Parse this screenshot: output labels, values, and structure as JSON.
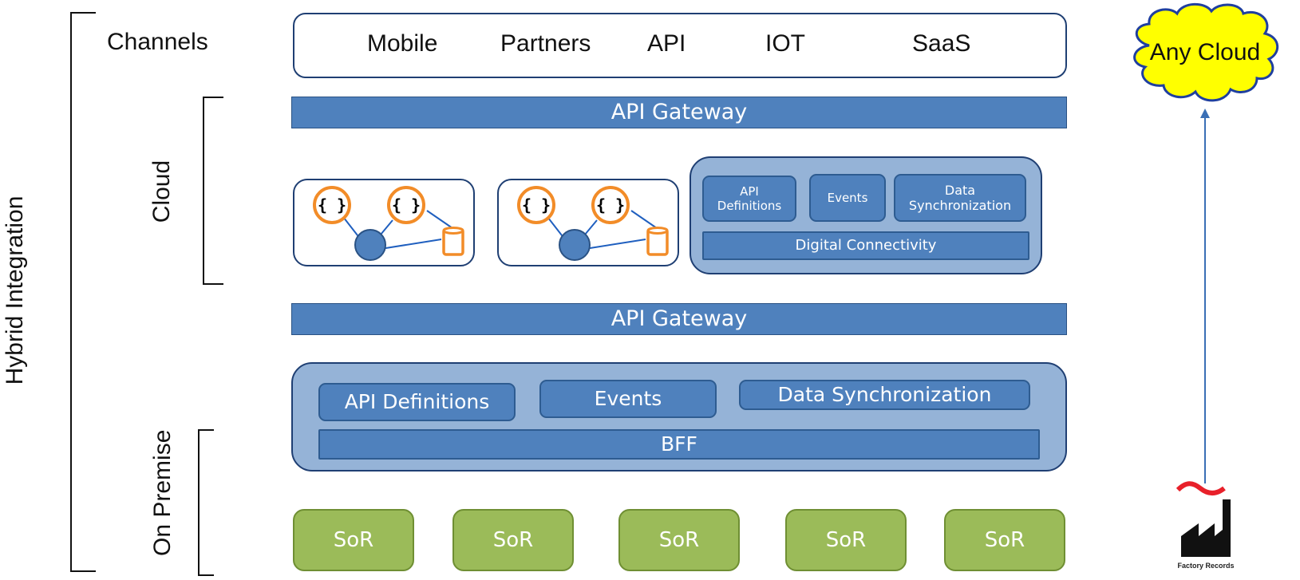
{
  "labels": {
    "hybrid_integration": "Hybrid Integration",
    "channels": "Channels",
    "cloud": "Cloud",
    "on_premise": "On Premise"
  },
  "channels": [
    "Mobile",
    "Partners",
    "API",
    "IOT",
    "SaaS"
  ],
  "cloud_layer": {
    "gateway_top": "API Gateway",
    "microservice_groups": [
      {
        "nodes": [
          "{ }",
          "{ }"
        ],
        "icons": [
          "code-node-icon",
          "code-node-icon",
          "service-node-icon",
          "database-icon"
        ]
      },
      {
        "nodes": [
          "{ }",
          "{ }"
        ],
        "icons": [
          "code-node-icon",
          "code-node-icon",
          "service-node-icon",
          "database-icon"
        ]
      }
    ],
    "digital_panel": {
      "tiles": [
        "API\nDefinitions",
        "Events",
        "Data\nSynchronization"
      ],
      "base": "Digital Connectivity"
    }
  },
  "gateway_middle": "API Gateway",
  "on_premise_layer": {
    "tiles": [
      "API Definitions",
      "Events",
      "Data Synchronization"
    ],
    "base": "BFF",
    "systems": [
      "SoR",
      "SoR",
      "SoR",
      "SoR",
      "SoR"
    ]
  },
  "external": {
    "cloud_label": "Any Cloud",
    "factory_caption": "Factory Records"
  },
  "colors": {
    "bar_blue": "#4f81bd",
    "panel_blue": "#95b3d7",
    "border_navy": "#1f3f73",
    "sor_green": "#9bbb59",
    "node_orange": "#f28c28",
    "cloud_yellow": "#ffff00"
  }
}
